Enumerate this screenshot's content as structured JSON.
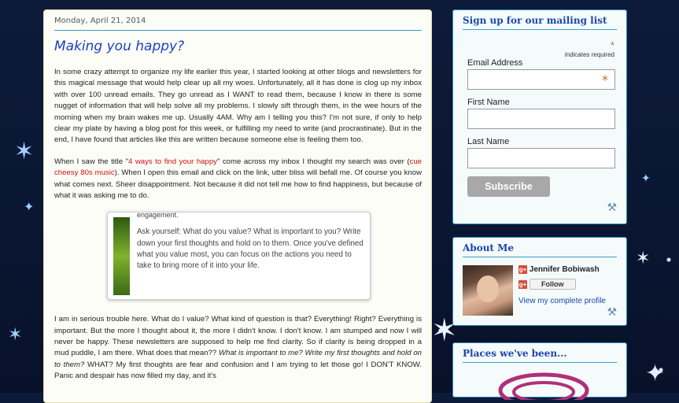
{
  "post": {
    "date": "Monday, April 21, 2014",
    "title": "Making you happy?",
    "p1": "In some crazy attempt to organize my life earlier this year, I started looking at other blogs and newsletters for this magical message that would help clear up all my woes.  Unfortunately, all it has done is clog up my inbox with over 100 unread emails.  They go unread as I WANT to read them, because I know in there is some nugget of information that will help solve all my problems.  I slowly sift through them, in the wee hours of the morning when my brain wakes me up.  Usually 4AM.  Why am I telling you this?  I'm not sure, if only to help clear my plate by having a blog post for this week, or fulfilling my need to write (and procrastinate).  But in the end, I have found that articles like this are written because someone else is feeling them too.",
    "p2_a": "When I saw the title \"",
    "p2_link1": "4 ways to find your happy",
    "p2_b": "\" come across my inbox I thought my search was over (",
    "p2_link2": "cue cheesy 80s music",
    "p2_c": ").  When I open this email and click on the link, utter bliss will befall me.  Of course you know what comes next.  Sheer disappointment.  Not because it did not tell me how to find happiness, but because of what it was asking me to do.",
    "quote_cut": "engagement.",
    "quote_text": "Ask yourself: What do you value? What is important to you? Write down your first thoughts and hold on to them. Once you've defined what you value most, you can focus on the actions you need to take to bring more of it into your life.",
    "p3_a": "I am in serious trouble here.  What do I value?  What kind of question is that?  Everything!  Right?  Everything is important.  But the more I thought about it, the more I didn't know.  I don't know.  I am stumped and now I will never be happy.  These newsletters are supposed to help me find clarity.  So if clarity is being dropped in a mud puddle, I am there.  What does that mean?? ",
    "p3_em": "What is important to me? Write my first thoughts and hold on to them?",
    "p3_b": " WHAT?  My first thoughts are fear and confusion and I am trying to let those go!  I DON'T KNOW.  Panic and despair has now filled my day, and it's"
  },
  "mailing": {
    "title": "Sign up for our mailing list",
    "required_mark": "*",
    "required_text": "indicates required",
    "email_label": "Email Address",
    "first_label": "First Name",
    "last_label": "Last Name",
    "subscribe": "Subscribe",
    "email_value": "",
    "first_value": "",
    "last_value": ""
  },
  "about": {
    "title": "About Me",
    "gplus": "g+",
    "name": "Jennifer Bobiwash",
    "follow": "Follow",
    "profile_link": "View my complete profile"
  },
  "places": {
    "title": "Places we've been..."
  },
  "icons": {
    "tool": "wrench-screwdriver-icon",
    "star": "sparkle-star-icon"
  }
}
